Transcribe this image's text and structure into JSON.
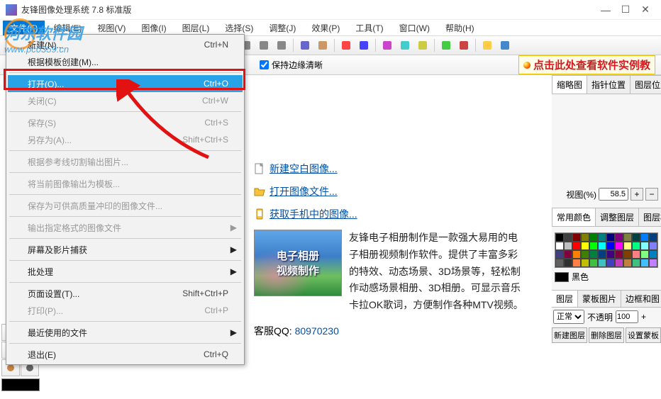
{
  "title": "友锋图像处理系统 7.8 标准版",
  "watermark": {
    "name": "河东软件园",
    "url": "www.pc0359.cn"
  },
  "menubar": [
    "文件(F)",
    "编辑(E)",
    "视图(V)",
    "图像(I)",
    "图层(L)",
    "选择(S)",
    "调整(J)",
    "效果(P)",
    "工具(T)",
    "窗口(W)",
    "帮助(H)"
  ],
  "toolbar2": {
    "checkbox_label": "保持边缘清晰",
    "banner": "点击此处查看软件实例教"
  },
  "dropdown": {
    "items": [
      {
        "label": "新建(N)...",
        "shortcut": "Ctrl+N",
        "disabled": false
      },
      {
        "label": "根据模板创建(M)...",
        "shortcut": "",
        "disabled": false
      },
      {
        "sep": true
      },
      {
        "label": "打开(O)...",
        "shortcut": "Ctrl+O",
        "disabled": false,
        "highlight": true
      },
      {
        "label": "关闭(C)",
        "shortcut": "Ctrl+W",
        "disabled": true
      },
      {
        "sep": true
      },
      {
        "label": "保存(S)",
        "shortcut": "Ctrl+S",
        "disabled": true
      },
      {
        "label": "另存为(A)...",
        "shortcut": "Shift+Ctrl+S",
        "disabled": true
      },
      {
        "sep": true
      },
      {
        "label": "根据参考线切割输出图片...",
        "shortcut": "",
        "disabled": true
      },
      {
        "sep": true
      },
      {
        "label": "将当前图像输出为模板...",
        "shortcut": "",
        "disabled": true
      },
      {
        "sep": true
      },
      {
        "label": "保存为可供高质量冲印的图像文件...",
        "shortcut": "",
        "disabled": true
      },
      {
        "sep": true
      },
      {
        "label": "输出指定格式的图像文件",
        "shortcut": "",
        "disabled": true,
        "arrow": true
      },
      {
        "sep": true
      },
      {
        "label": "屏幕及影片捕获",
        "shortcut": "",
        "disabled": false,
        "arrow": true
      },
      {
        "sep": true
      },
      {
        "label": "批处理",
        "shortcut": "",
        "disabled": false,
        "arrow": true
      },
      {
        "sep": true
      },
      {
        "label": "页面设置(T)...",
        "shortcut": "Shift+Ctrl+P",
        "disabled": false
      },
      {
        "label": "打印(P)...",
        "shortcut": "Ctrl+P",
        "disabled": true
      },
      {
        "sep": true
      },
      {
        "label": "最近使用的文件",
        "shortcut": "",
        "disabled": false,
        "arrow": true
      },
      {
        "sep": true
      },
      {
        "label": "退出(E)",
        "shortcut": "Ctrl+Q",
        "disabled": false
      }
    ]
  },
  "content": {
    "link1": "新建空白图像...",
    "link2": "打开图像文件...",
    "link3": "获取手机中的图像...",
    "thumb_l1": "电子相册",
    "thumb_l2": "视频制作",
    "desc": "友锋电子相册制作是一款强大易用的电子相册视频制作软件。提供了丰富多彩的特效、动态场景、3D场景等，轻松制作动感场景相册、3D相册。可显示音乐卡拉OK歌词，方便制作各种MTV视频。",
    "qq_label": "客服QQ: ",
    "qq_num": "80970230"
  },
  "rpanel": {
    "tabs_top": [
      "缩略图",
      "指针位置",
      "图层位置"
    ],
    "view_label": "视图(%)",
    "view_value": "58.5",
    "tabs_mid": [
      "常用颜色",
      "调整图层",
      "图层样"
    ],
    "cur_color": "黑色",
    "tabs_bot": [
      "图层",
      "蒙板图片",
      "边框和图"
    ],
    "blend_mode": "正常",
    "opacity_label": "不透明",
    "opacity_value": "100",
    "layer_btns": [
      "新建图层",
      "删除图层",
      "设置蒙板"
    ]
  },
  "swatch_colors": [
    "#000",
    "#404040",
    "#800000",
    "#808000",
    "#008000",
    "#008080",
    "#000080",
    "#800080",
    "#808040",
    "#004040",
    "#0080ff",
    "#004080",
    "#fff",
    "#c0c0c0",
    "#ff0000",
    "#ffff00",
    "#00ff00",
    "#00ffff",
    "#0000ff",
    "#ff00ff",
    "#ffff80",
    "#00ff80",
    "#80ffff",
    "#8080ff",
    "#404080",
    "#800040",
    "#ff8000",
    "#408000",
    "#008040",
    "#004080",
    "#400080",
    "#800040",
    "#804000",
    "#ff8080",
    "#80ff80",
    "#0080c0",
    "#606060",
    "#303030",
    "#ff8040",
    "#c0c000",
    "#40c040",
    "#40c0c0",
    "#4040c0",
    "#c040c0",
    "#c08040",
    "#40c080",
    "#40c0ff",
    "#c080ff"
  ]
}
